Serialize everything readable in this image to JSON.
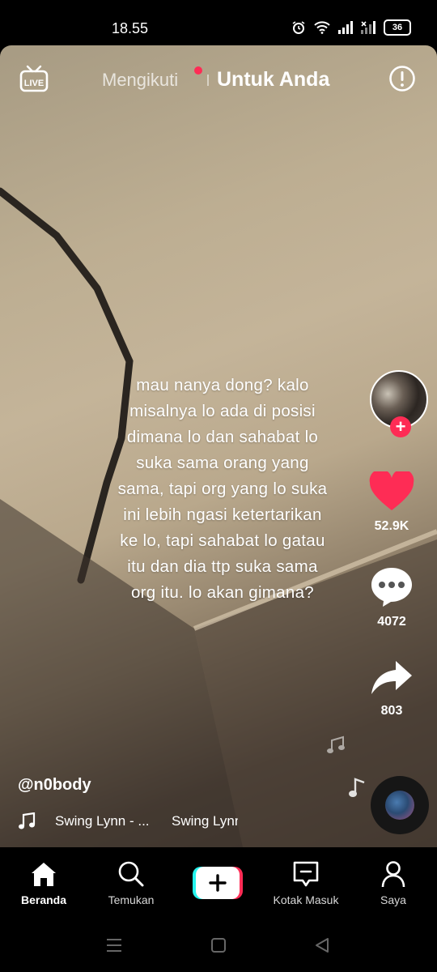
{
  "status": {
    "time": "18.55",
    "battery": "36"
  },
  "topnav": {
    "following_label": "Mengikuti",
    "for_you_label": "Untuk Anda",
    "live_label": "LIVE"
  },
  "caption": [
    "mau nanya dong? kalo",
    "misalnya lo ada di posisi",
    "dimana lo dan sahabat lo",
    "suka sama orang yang",
    "sama, tapi org yang lo suka",
    "ini lebih ngasi ketertarikan",
    "ke lo, tapi sahabat lo gatau",
    "itu dan dia ttp suka sama",
    "org itu. lo akan gimana?"
  ],
  "actions": {
    "likes": "52.9K",
    "comments": "4072",
    "shares": "803"
  },
  "author": {
    "username": "@n0body"
  },
  "music": {
    "title": "Swing Lynn - ...",
    "title2": "Swing Lynn"
  },
  "bottom_nav": [
    {
      "label": "Beranda",
      "icon": "home-icon",
      "active": true
    },
    {
      "label": "Temukan",
      "icon": "search-icon"
    },
    {
      "label": "",
      "icon": "create-plus-icon"
    },
    {
      "label": "Kotak Masuk",
      "icon": "inbox-icon"
    },
    {
      "label": "Saya",
      "icon": "profile-icon"
    }
  ],
  "colors": {
    "accent": "#fe2c55",
    "cyan": "#25f4ee",
    "background": "#000000"
  }
}
